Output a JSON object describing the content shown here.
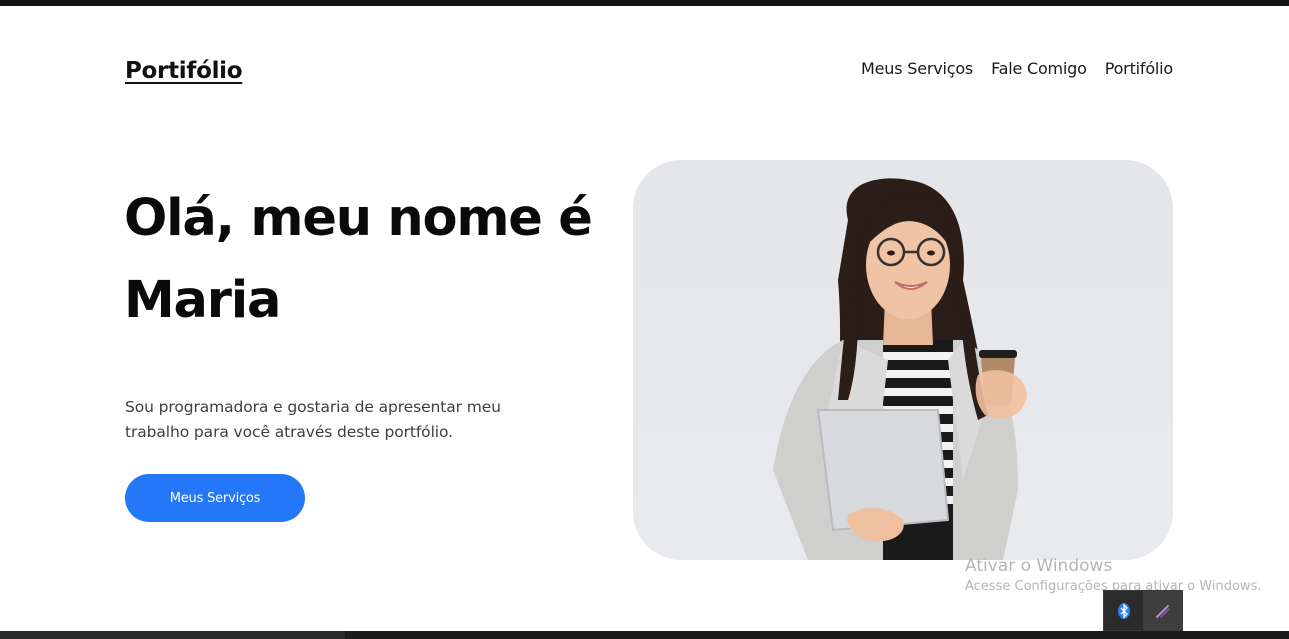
{
  "header": {
    "logo": "Portifólio",
    "nav": [
      "Meus Serviços",
      "Fale Comigo",
      "Portifólio"
    ]
  },
  "hero": {
    "title": "Olá, meu nome é Maria",
    "description": "Sou programadora e gostaria de apresentar meu trabalho para você através deste portfólio.",
    "cta_label": "Meus Serviços"
  },
  "windows_activation": {
    "title": "Ativar o Windows",
    "subtitle": "Acesse Configurações para ativar o Windows."
  },
  "tray": {
    "icons": [
      "bluetooth-icon",
      "pen-icon"
    ]
  },
  "colors": {
    "accent": "#2477f7",
    "photo_background": "#e6e8eb"
  }
}
